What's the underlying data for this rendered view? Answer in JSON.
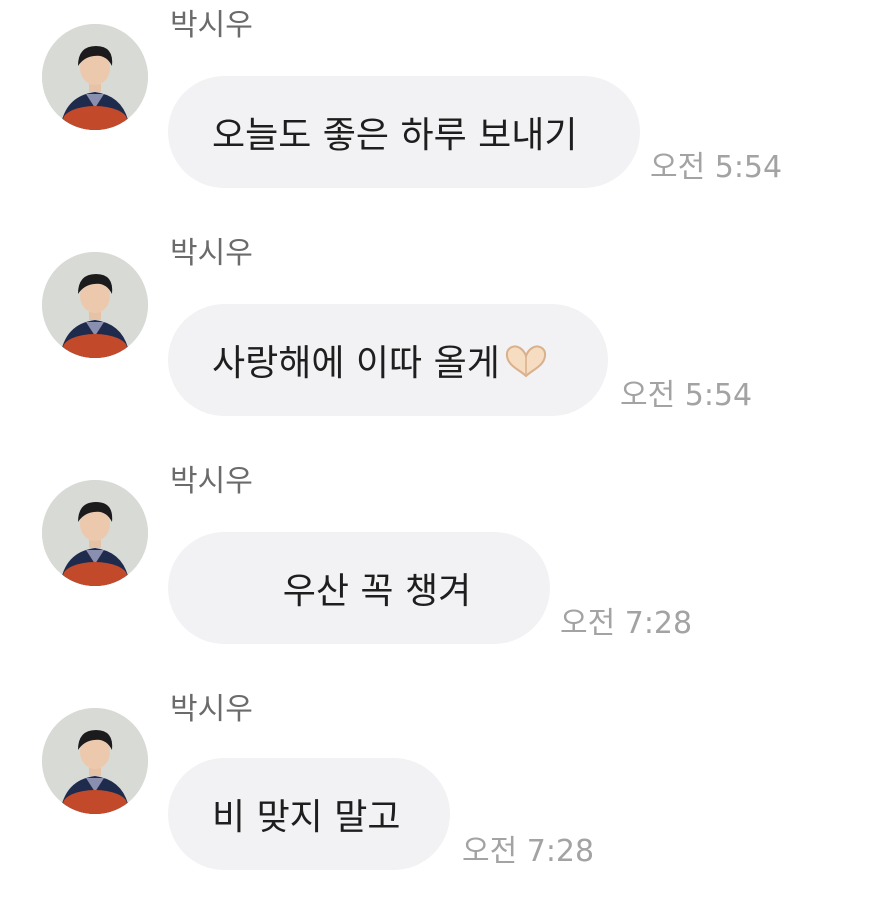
{
  "messages": [
    {
      "sender": "박시우",
      "text": "오늘도 좋은 하루 보내기",
      "time": "오전 5:54",
      "emoji": ""
    },
    {
      "sender": "박시우",
      "text": "사랑해에 이따 올게",
      "time": "오전 5:54",
      "emoji": "heart-hands-icon"
    },
    {
      "sender": "박시우",
      "text": "우산 꼭 챙겨",
      "time": "오전 7:28",
      "emoji": ""
    },
    {
      "sender": "박시우",
      "text": "비 맞지 말고",
      "time": "오전 7:28",
      "emoji": ""
    }
  ],
  "colors": {
    "bubble": "#f2f2f4",
    "sender": "#6b6b6b",
    "time": "#a3a3a3",
    "text": "#1e1e1e"
  }
}
